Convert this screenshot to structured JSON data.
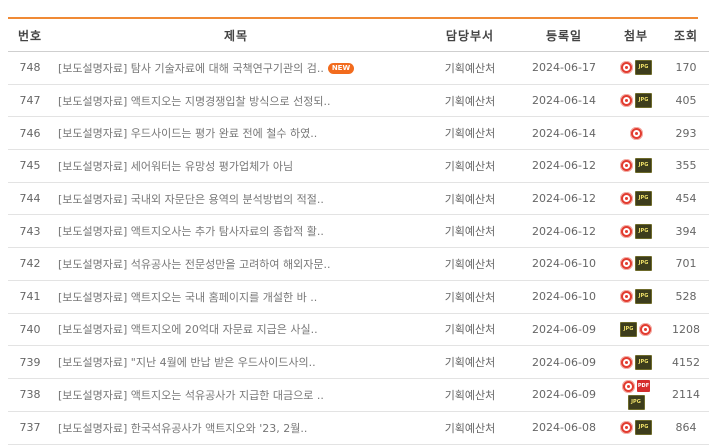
{
  "columns": {
    "num": "번호",
    "title": "제목",
    "dept": "담당부서",
    "date": "등록일",
    "attach": "첨부",
    "views": "조회"
  },
  "badge_new": "NEW",
  "rows": [
    {
      "num": "748",
      "title": "[보도설명자료] 탐사 기술자료에 대해 국책연구기관의 검..",
      "new": true,
      "dept": "기획예산처",
      "date": "2024-06-17",
      "attach": [
        "pdf-icon",
        "jpg-icon"
      ],
      "views": "170"
    },
    {
      "num": "747",
      "title": "[보도설명자료] 액트지오는 지명경쟁입찰 방식으로 선정되..",
      "new": false,
      "dept": "기획예산처",
      "date": "2024-06-14",
      "attach": [
        "pdf-icon",
        "jpg-icon"
      ],
      "views": "405"
    },
    {
      "num": "746",
      "title": "[보도설명자료] 우드사이드는 평가 완료 전에 철수 하였..",
      "new": false,
      "dept": "기획예산처",
      "date": "2024-06-14",
      "attach": [
        "pdf-icon"
      ],
      "views": "293"
    },
    {
      "num": "745",
      "title": "[보도설명자료] 세어워터는 유망성 평가업체가 아님",
      "new": false,
      "dept": "기획예산처",
      "date": "2024-06-12",
      "attach": [
        "pdf-icon",
        "jpg-icon"
      ],
      "views": "355"
    },
    {
      "num": "744",
      "title": "[보도설명자료] 국내외 자문단은 용역의 분석방법의 적절..",
      "new": false,
      "dept": "기획예산처",
      "date": "2024-06-12",
      "attach": [
        "pdf-icon",
        "jpg-icon"
      ],
      "views": "454"
    },
    {
      "num": "743",
      "title": "[보도설명자료] 액트지오사는 추가 탐사자료의 종합적 활..",
      "new": false,
      "dept": "기획예산처",
      "date": "2024-06-12",
      "attach": [
        "pdf-icon",
        "jpg-icon"
      ],
      "views": "394"
    },
    {
      "num": "742",
      "title": "[보도설명자료] 석유공사는 전문성만을 고려하여 해외자문..",
      "new": false,
      "dept": "기획예산처",
      "date": "2024-06-10",
      "attach": [
        "pdf-icon",
        "jpg-icon"
      ],
      "views": "701"
    },
    {
      "num": "741",
      "title": "[보도설명자료] 액트지오는 국내 홈페이지를 개설한 바 ..",
      "new": false,
      "dept": "기획예산처",
      "date": "2024-06-10",
      "attach": [
        "pdf-icon",
        "jpg-icon"
      ],
      "views": "528"
    },
    {
      "num": "740",
      "title": "[보도설명자료] 액트지오에 20억대 자문료 지급은 사실..",
      "new": false,
      "dept": "기획예산처",
      "date": "2024-06-09",
      "attach": [
        "jpg-icon",
        "pdf-icon"
      ],
      "views": "1208"
    },
    {
      "num": "739",
      "title": "[보도설명자료] \"지난 4월에 반납 받은 우드사이드사의..",
      "new": false,
      "dept": "기획예산처",
      "date": "2024-06-09",
      "attach": [
        "pdf-icon",
        "jpg-icon"
      ],
      "views": "4152"
    },
    {
      "num": "738",
      "title": "[보도설명자료] 액트지오는 석유공사가 지급한 대금으로 ..",
      "new": false,
      "dept": "기획예산처",
      "date": "2024-06-09",
      "attach": [
        "pdf-icon",
        "pdf-file-icon",
        "jpg-icon"
      ],
      "views": "2114"
    },
    {
      "num": "737",
      "title": "[보도설명자료] 한국석유공사가 액트지오와 '23, 2월..",
      "new": false,
      "dept": "기획예산처",
      "date": "2024-06-08",
      "attach": [
        "pdf-icon",
        "jpg-icon"
      ],
      "views": "864"
    }
  ],
  "colors": {
    "accent": "#f08a35",
    "new_badge": "#f26b1d"
  }
}
